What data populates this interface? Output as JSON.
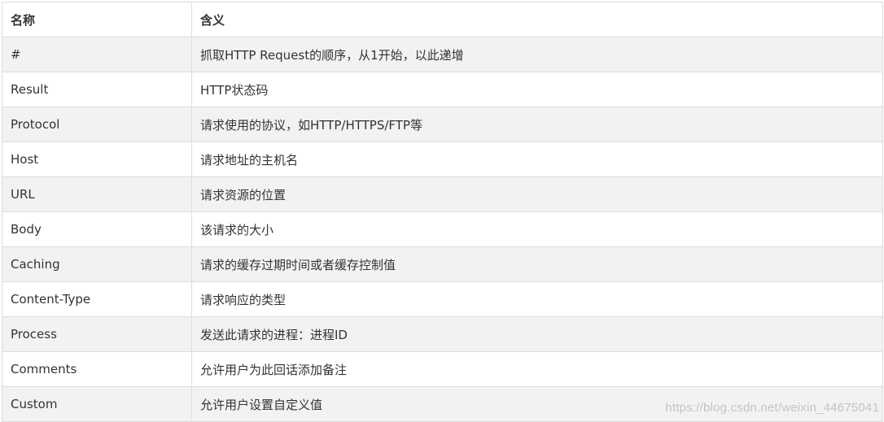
{
  "table": {
    "headers": [
      "名称",
      "含义"
    ],
    "rows": [
      [
        "#",
        "抓取HTTP Request的顺序，从1开始，以此递增"
      ],
      [
        "Result",
        "HTTP状态码"
      ],
      [
        "Protocol",
        "请求使用的协议，如HTTP/HTTPS/FTP等"
      ],
      [
        "Host",
        "请求地址的主机名"
      ],
      [
        "URL",
        "请求资源的位置"
      ],
      [
        "Body",
        "该请求的大小"
      ],
      [
        "Caching",
        "请求的缓存过期时间或者缓存控制值"
      ],
      [
        "Content-Type",
        "请求响应的类型"
      ],
      [
        "Process",
        "发送此请求的进程：进程ID"
      ],
      [
        "Comments",
        "允许用户为此回话添加备注"
      ],
      [
        "Custom",
        "允许用户设置自定义值"
      ]
    ]
  },
  "watermark": "https://blog.csdn.net/weixin_44675041",
  "colors": {
    "border": "#dcdcdc",
    "stripe": "#f2f2f2",
    "text": "#333333"
  }
}
